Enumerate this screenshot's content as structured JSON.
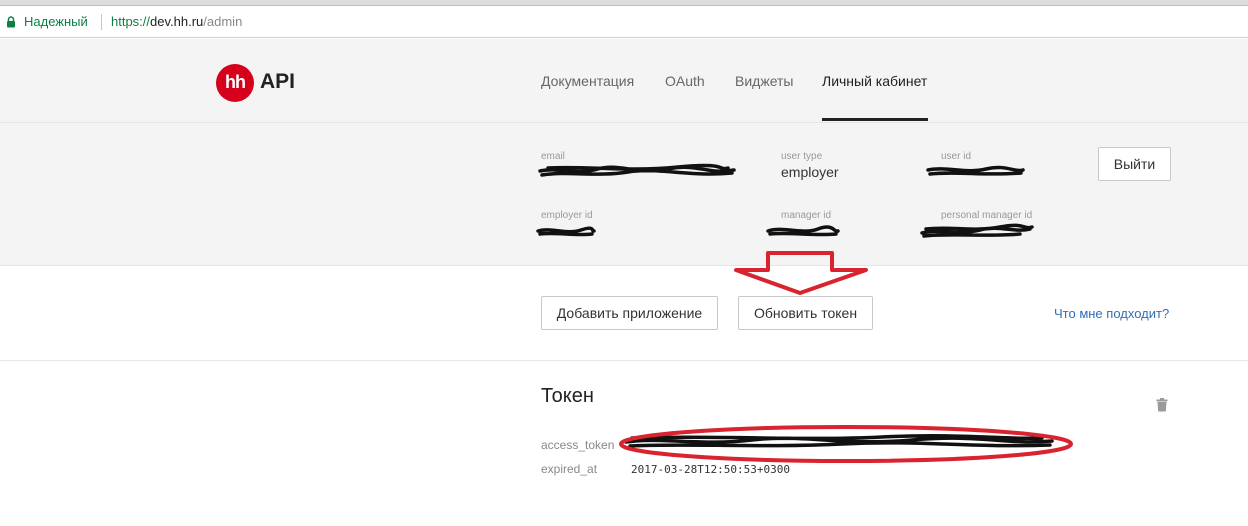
{
  "browser": {
    "secure_label": "Надежный",
    "url_scheme": "https://",
    "url_host": "dev.hh.ru",
    "url_path": "/admin"
  },
  "header": {
    "logo_mark": "hh",
    "logo_text": "API",
    "nav": [
      {
        "label": "Документация"
      },
      {
        "label": "OAuth"
      },
      {
        "label": "Виджеты"
      },
      {
        "label": "Личный кабинет",
        "active": true
      }
    ]
  },
  "profile": {
    "email_label": "email",
    "user_type_label": "user type",
    "user_type_value": "employer",
    "user_id_label": "user id",
    "employer_id_label": "employer id",
    "manager_id_label": "manager id",
    "personal_manager_id_label": "personal manager id",
    "logout_label": "Выйти"
  },
  "actions": {
    "add_app_label": "Добавить приложение",
    "refresh_token_label": "Обновить токен",
    "help_link": "Что мне подходит?"
  },
  "token": {
    "title": "Токен",
    "access_token_label": "access_token",
    "expired_at_label": "expired_at",
    "expired_at_value": "2017-03-28T12:50:53+0300"
  },
  "icons": {
    "lock": "lock-icon",
    "trash": "trash-icon"
  },
  "colors": {
    "brand_red": "#d6001c",
    "secure_green": "#0b8043",
    "link_blue": "#2f6fb6",
    "annotation_red": "#d9232e"
  }
}
